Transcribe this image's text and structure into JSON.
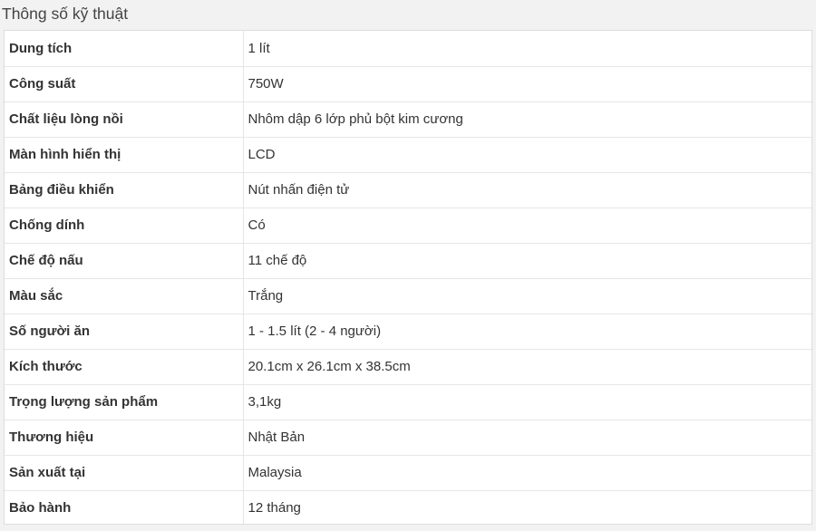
{
  "header": {
    "title": "Thông số kỹ thuật"
  },
  "specs": [
    {
      "label": "Dung tích",
      "value": "1 lít"
    },
    {
      "label": "Công suất",
      "value": "750W"
    },
    {
      "label": "Chất liệu lòng nồi",
      "value": "Nhôm dập 6 lớp phủ bột kim cương"
    },
    {
      "label": "Màn hình hiển thị",
      "value": "LCD"
    },
    {
      "label": "Bảng điều khiển",
      "value": "Nút nhấn điện tử"
    },
    {
      "label": "Chống dính",
      "value": "Có"
    },
    {
      "label": "Chế độ nấu",
      "value": "11 chế độ"
    },
    {
      "label": "Màu sắc",
      "value": "Trắng"
    },
    {
      "label": "Số người ăn",
      "value": "1 - 1.5 lít (2 - 4 người)"
    },
    {
      "label": "Kích thước",
      "value": "20.1cm x 26.1cm x 38.5cm"
    },
    {
      "label": "Trọng lượng sản phẩm",
      "value": "3,1kg"
    },
    {
      "label": "Thương hiệu",
      "value": "Nhật Bản"
    },
    {
      "label": "Sản xuất tại",
      "value": "Malaysia"
    },
    {
      "label": "Bảo hành",
      "value": "12 tháng"
    }
  ]
}
